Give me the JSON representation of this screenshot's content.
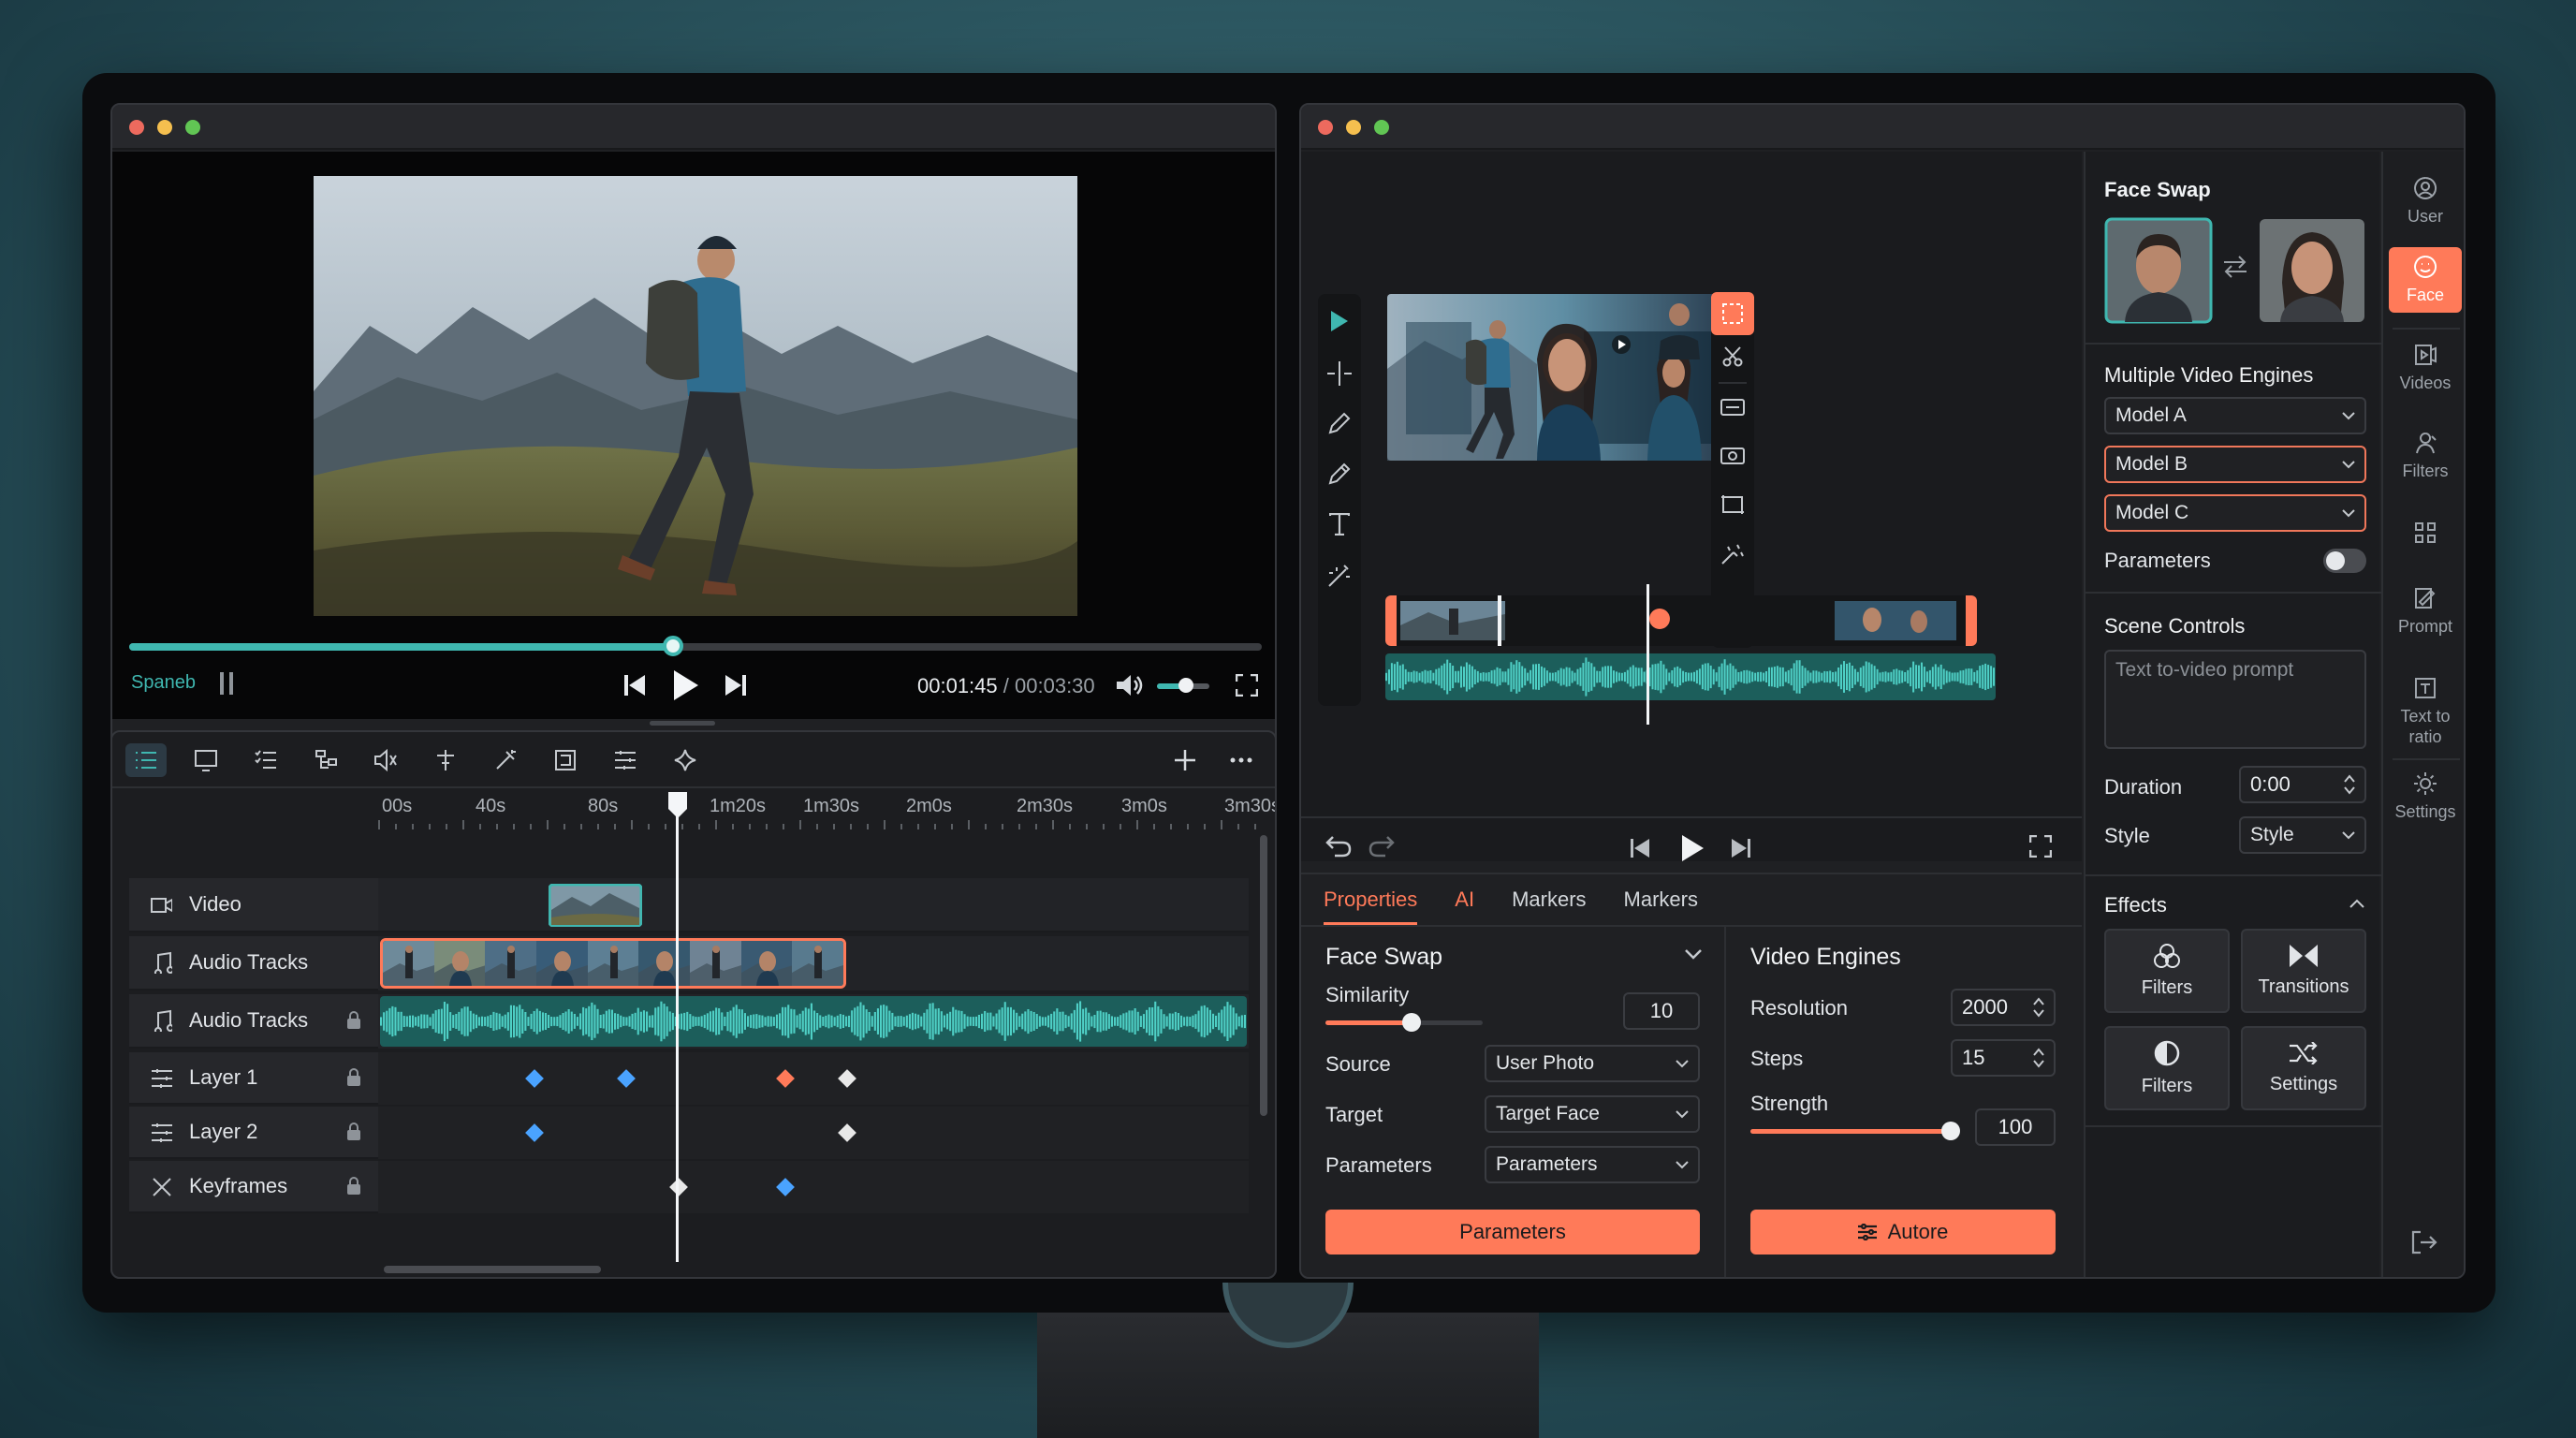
{
  "colors": {
    "accent": "#ff7a59",
    "teal": "#3fb7b0",
    "keyframe_blue": "#4aa3ff",
    "keyframe_white": "#e8e8e8"
  },
  "left_window": {
    "player": {
      "progress": 0.48,
      "volume": 0.55,
      "status_label": "Spaneb",
      "current_time": "00:01:45",
      "separator": "/",
      "total_time": "00:03:30"
    },
    "toolbar_icons": [
      "list-icon",
      "monitor-icon",
      "checklist-icon",
      "tree-icon",
      "audio-icon",
      "move-icon",
      "magic-icon",
      "crop-icon",
      "layers-icon",
      "sparkle-icon"
    ],
    "timeline": {
      "ruler": [
        "00s",
        "40s",
        "80s",
        "1m20s",
        "1m30s",
        "2m0s",
        "2m30s",
        "3m0s",
        "3m30s"
      ],
      "playhead_label": "1m20s",
      "tracks": [
        {
          "label": "Video",
          "icon": "video-camera-icon",
          "locked": false
        },
        {
          "label": "Audio Tracks",
          "icon": "music-note-icon",
          "locked": false
        },
        {
          "label": "Audio Tracks",
          "icon": "music-note-icon",
          "locked": true
        },
        {
          "label": "Layer 1",
          "icon": "layers-icon",
          "locked": true
        },
        {
          "label": "Layer 2",
          "icon": "layers-icon",
          "locked": true
        },
        {
          "label": "Keyframes",
          "icon": "keyframes-icon",
          "locked": true
        }
      ]
    }
  },
  "right_window": {
    "tabs": [
      "Properties",
      "AI",
      "Markers",
      "Markers"
    ],
    "face_swap": {
      "title": "Face Swap",
      "similarity_label": "Similarity",
      "similarity_value": "10",
      "similarity_fraction": 0.55,
      "source_label": "Source",
      "source_value": "User Photo",
      "target_label": "Target",
      "target_value": "Target Face",
      "parameters_label": "Parameters",
      "parameters_value": "Parameters",
      "button": "Parameters"
    },
    "video_engines": {
      "title": "Video Engines",
      "resolution_label": "Resolution",
      "resolution_value": "2000",
      "steps_label": "Steps",
      "steps_value": "15",
      "strength_label": "Strength",
      "strength_value": "100",
      "strength_fraction": 0.98,
      "button": "Autore"
    },
    "settings_panel": {
      "face_swap_title": "Face Swap",
      "engines_title": "Multiple Video Engines",
      "models": [
        "Model A",
        "Model B",
        "Model C"
      ],
      "selected_models": [
        1,
        2
      ],
      "parameters_label": "Parameters",
      "parameters_toggle": false,
      "scene_title": "Scene Controls",
      "prompt_placeholder": "Text to-video prompt",
      "duration_label": "Duration",
      "duration_value": "0:00",
      "style_label": "Style",
      "style_value": "Style",
      "effects_title": "Effects",
      "effects": [
        "Filters",
        "Transitions",
        "Filters",
        "Settings"
      ]
    },
    "sidebar": [
      {
        "label": "User",
        "icon": "user-icon",
        "active": false
      },
      {
        "label": "Face",
        "icon": "face-icon",
        "active": true
      },
      {
        "label": "Videos",
        "icon": "video-icon",
        "active": false
      },
      {
        "label": "Filters",
        "icon": "filters-icon",
        "active": false
      },
      {
        "label": "",
        "icon": "grid-icon",
        "active": false
      },
      {
        "label": "Prompt",
        "icon": "prompt-icon",
        "active": false
      },
      {
        "label": "Text to ratio",
        "icon": "text-ratio-icon",
        "active": false
      },
      {
        "label": "Settings",
        "icon": "gear-icon",
        "active": false
      }
    ]
  }
}
